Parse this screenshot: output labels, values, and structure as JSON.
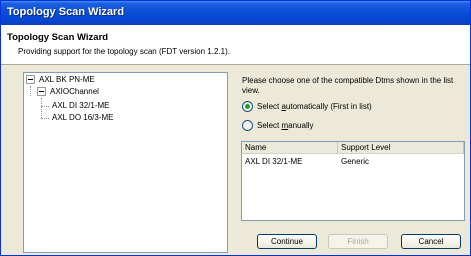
{
  "window": {
    "title": "Topology Scan Wizard"
  },
  "header": {
    "title": "Topology Scan Wizard",
    "subtitle": "Providing support for the topology scan (FDT version 1.2.1)."
  },
  "tree": {
    "items": [
      {
        "label": "AXL BK PN-ME"
      },
      {
        "label": "AXIOChannel"
      },
      {
        "label": "AXL DI 32/1-ME"
      },
      {
        "label": "AXL DO 16/3-ME"
      }
    ]
  },
  "panel": {
    "instructions": "Please choose one of the compatible Dtms shown in the list view.",
    "radio_auto": {
      "pre": "Select ",
      "access": "a",
      "post": "utomatically (First in list)",
      "selected": true
    },
    "radio_manual": {
      "pre": "Select ",
      "access": "m",
      "post": "anually",
      "selected": false
    }
  },
  "listview": {
    "columns": [
      "Name",
      "Support Level"
    ],
    "rows": [
      {
        "name": "AXL DI 32/1-ME",
        "support": "Generic"
      }
    ]
  },
  "buttons": {
    "continue": "Continue",
    "finish": "Finish",
    "cancel": "Cancel"
  },
  "colors": {
    "titlebar": "#0a4fd8",
    "dialog_bg": "#ece9d8",
    "radio_dot": "#21a121"
  }
}
